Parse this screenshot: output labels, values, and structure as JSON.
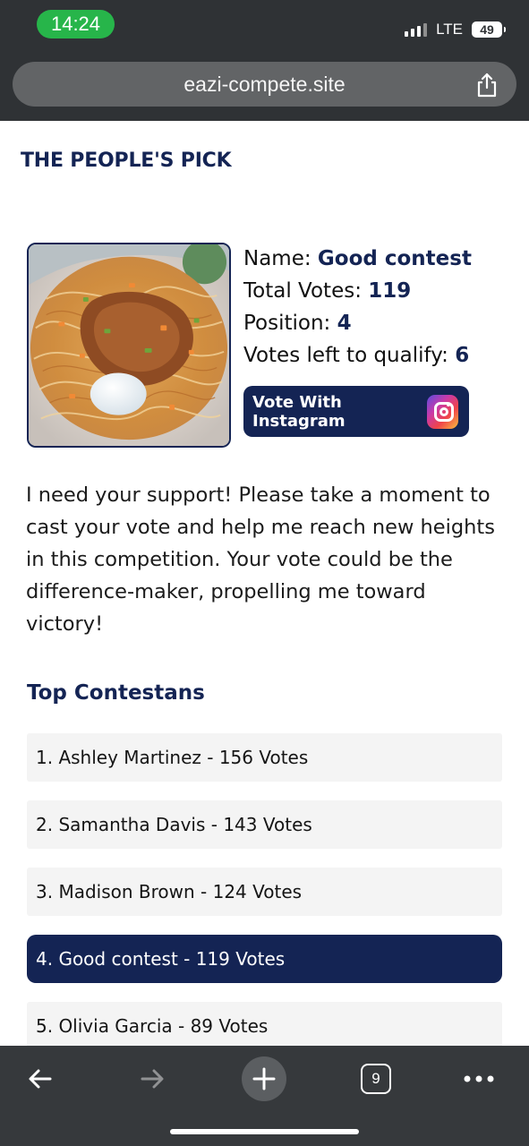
{
  "status_bar": {
    "time": "14:24",
    "network": "LTE",
    "battery": "49"
  },
  "browser": {
    "url": "eazi-compete.site",
    "tab_count": "9"
  },
  "page": {
    "site_title": "THE PEOPLE'S PICK",
    "profile": {
      "name_label": "Name: ",
      "name_value": "Good contest",
      "votes_label": "Total Votes: ",
      "votes_value": "119",
      "position_label": "Position: ",
      "position_value": "4",
      "left_label": "Votes left to qualify: ",
      "left_value": "6"
    },
    "vote_button_label": "Vote With Instagram",
    "message": "I need your support! Please take a moment to cast your vote and help me reach new heights in this competition. Your vote could be the difference-maker, propelling me toward victory!",
    "leaderboard_title": "Top Contestans",
    "leaderboard": [
      "1. Ashley Martinez - 156 Votes",
      "2. Samantha Davis - 143 Votes",
      "3. Madison Brown - 124 Votes",
      "4. Good contest - 119 Votes",
      "5. Olivia Garcia - 89 Votes"
    ]
  },
  "icons": {
    "share": "share-icon",
    "back": "arrow-left-icon",
    "forward": "arrow-right-icon",
    "new_tab": "plus-icon",
    "tabs": "tabs-icon",
    "more": "more-icon",
    "instagram": "instagram-icon"
  },
  "colors": {
    "accent": "#142454",
    "status_green": "#27b54a",
    "browser_bar": "#2f3235"
  }
}
